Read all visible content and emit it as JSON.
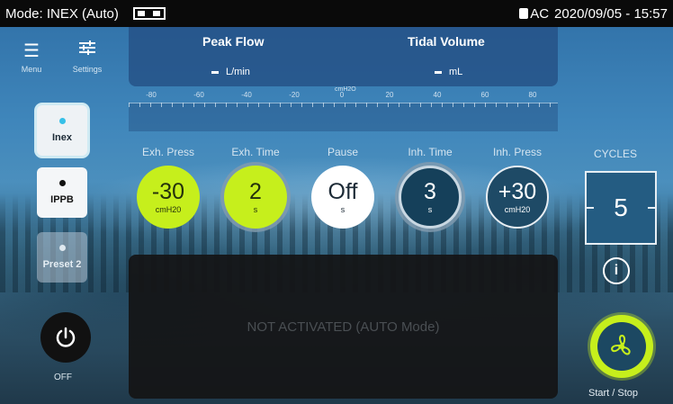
{
  "status_bar": {
    "mode_title": "Mode: INEX (Auto)",
    "power_source": "AC",
    "datetime": "2020/09/05 - 15:57"
  },
  "nav": {
    "menu_label": "Menu",
    "settings_label": "Settings"
  },
  "monitor": {
    "peak_flow_label": "Peak Flow",
    "peak_flow_unit": "L/min",
    "tidal_volume_label": "Tidal Volume",
    "tidal_volume_unit": "mL",
    "scale_unit": "cmH2O",
    "scale_ticks": [
      "-80",
      "-60",
      "-40",
      "-20",
      "0",
      "20",
      "40",
      "60",
      "80"
    ]
  },
  "modes": {
    "inex": "Inex",
    "ippb": "IPPB",
    "preset2": "Preset 2"
  },
  "params": {
    "exh_press": {
      "label": "Exh. Press",
      "value": "-30",
      "unit": "cmH20"
    },
    "exh_time": {
      "label": "Exh. Time",
      "value": "2",
      "unit": "s"
    },
    "pause": {
      "label": "Pause",
      "value": "Off",
      "unit": "s"
    },
    "inh_time": {
      "label": "Inh. Time",
      "value": "3",
      "unit": "s"
    },
    "inh_press": {
      "label": "Inh. Press",
      "value": "+30",
      "unit": "cmH20"
    }
  },
  "cycles": {
    "label": "CYCLES",
    "value": "5"
  },
  "main": {
    "message": "NOT ACTIVATED (AUTO Mode)"
  },
  "power": {
    "label": "OFF"
  },
  "start_stop": {
    "label": "Start / Stop"
  },
  "colors": {
    "accent_green": "#c6ef1c",
    "panel_blue": "#265287",
    "status_bar": "#0a0a0a"
  }
}
